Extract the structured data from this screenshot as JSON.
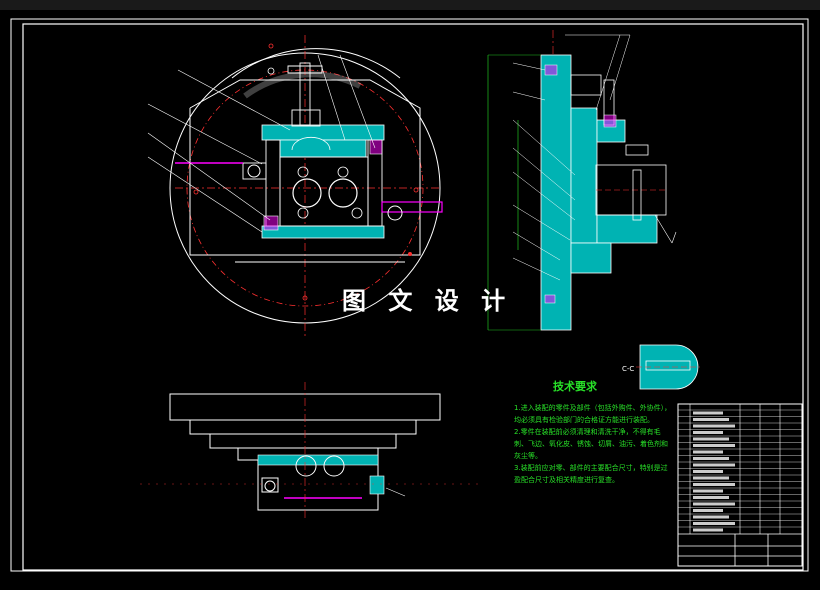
{
  "watermark": "图 文 设 计",
  "tech": {
    "title": "技术要求",
    "notes": [
      "1.进入装配的零件及部件（包括外购件、外协件），均必须具有检验部门的合格证方能进行装配。",
      "2.零件在装配前必须清理和清洗干净，不得有毛刺、飞边、氧化皮、锈蚀、切屑、油污、着色剂和灰尘等。",
      "3.装配前应对零、部件的主要配合尺寸，特别是过盈配合尺寸及相关精度进行复查。"
    ]
  },
  "section_label": "C-C",
  "colors": {
    "line": "#ffffff",
    "part": "#00b3b3",
    "hidden": "#ff2020",
    "dim": "#20c020",
    "accent": "#ff00ff",
    "text": "#28e028"
  }
}
